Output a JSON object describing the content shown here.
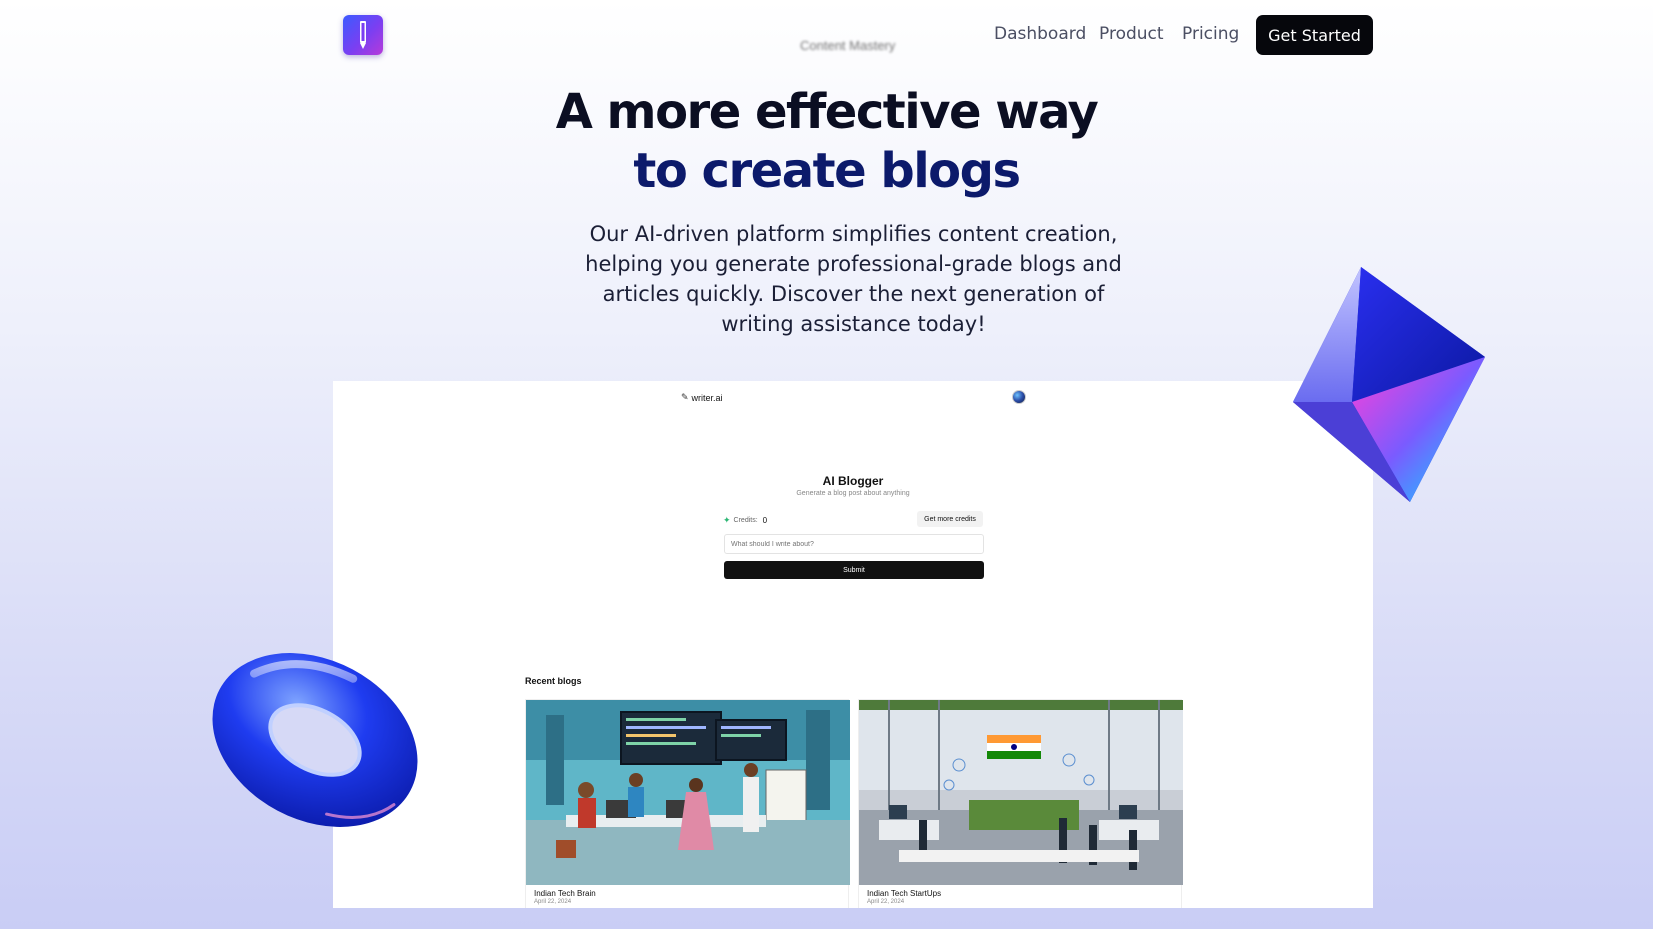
{
  "nav": {
    "faded_label": "Content Mastery",
    "links": [
      "Dashboard",
      "Product",
      "Pricing"
    ],
    "cta_label": "Get Started"
  },
  "hero": {
    "headline_line1": "A more effective way",
    "headline_line2": "to create blogs",
    "subtitle": "Our AI-driven platform simplifies content creation, helping you generate professional-grade blogs and articles quickly. Discover the next generation of writing assistance today!"
  },
  "preview": {
    "brand": "writer.ai",
    "title": "AI Blogger",
    "subtitle": "Generate a blog post about anything",
    "credits_label": "Credits:",
    "credits_value": "0",
    "get_more_label": "Get more credits",
    "input_placeholder": "What should I write about?",
    "submit_label": "Submit",
    "recent_label": "Recent blogs",
    "blogs": [
      {
        "title": "Indian Tech Brain",
        "date": "April 22, 2024"
      },
      {
        "title": "Indian Tech StartUps",
        "date": "April 22, 2024"
      }
    ]
  },
  "colors": {
    "cta_bg": "#06070c",
    "headline_dark": "#0b0e22",
    "headline_navy": "#0c1a6b",
    "credits_icon": "#2bb673"
  },
  "icons": [
    "pen-logo-icon",
    "pen-icon",
    "avatar-icon",
    "sparkle-icon"
  ]
}
